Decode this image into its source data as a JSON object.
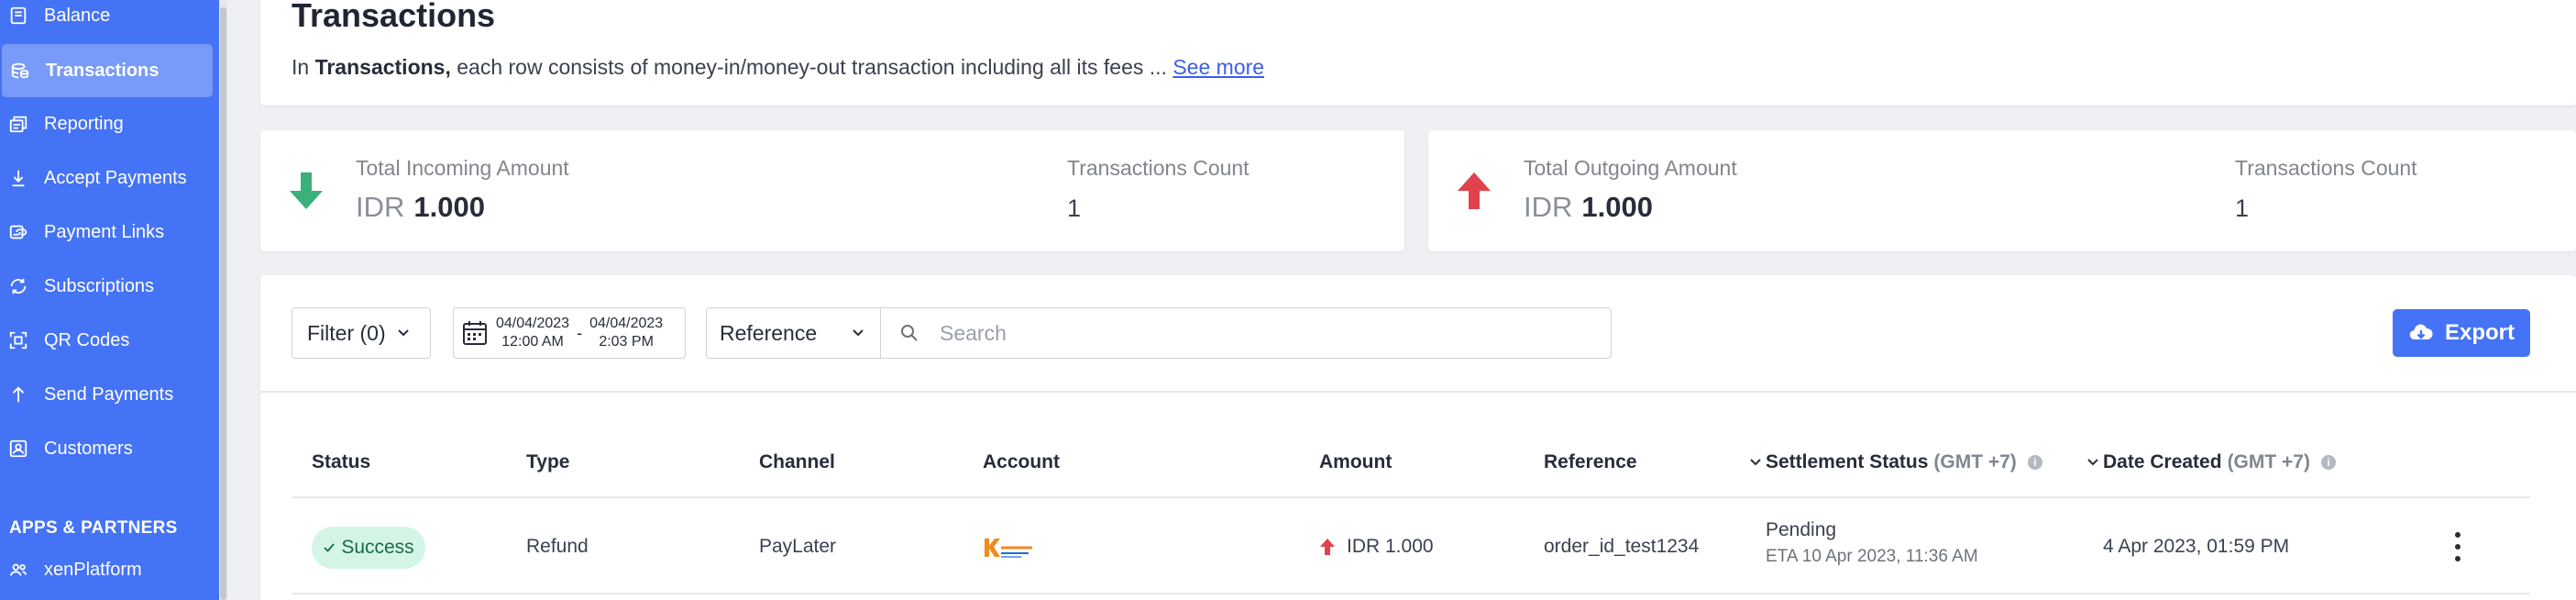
{
  "sidebar": {
    "items": [
      {
        "label": "Balance",
        "icon": "balance-icon"
      },
      {
        "label": "Transactions",
        "icon": "transactions-icon",
        "active": true
      },
      {
        "label": "Reporting",
        "icon": "reporting-icon"
      },
      {
        "label": "Accept Payments",
        "icon": "accept-payments-icon"
      },
      {
        "label": "Payment Links",
        "icon": "payment-links-icon"
      },
      {
        "label": "Subscriptions",
        "icon": "subscriptions-icon"
      },
      {
        "label": "QR Codes",
        "icon": "qr-code-icon"
      },
      {
        "label": "Send Payments",
        "icon": "send-payments-icon"
      },
      {
        "label": "Customers",
        "icon": "customers-icon"
      }
    ],
    "section_title": "APPS & PARTNERS",
    "apps": [
      {
        "label": "xenPlatform",
        "icon": "users-icon"
      }
    ],
    "color": "#4573f5"
  },
  "header": {
    "title": "Transactions",
    "desc_prefix": "In ",
    "desc_bold": "Transactions,",
    "desc_rest": " each row consists of money-in/money-out transaction including all its fees ... ",
    "see_more": "See more"
  },
  "summary": {
    "incoming": {
      "label": "Total Incoming Amount",
      "currency": "IDR",
      "amount": "1.000",
      "count_label": "Transactions Count",
      "count": "1",
      "arrow_color": "#3ab07a"
    },
    "outgoing": {
      "label": "Total Outgoing Amount",
      "currency": "IDR",
      "amount": "1.000",
      "count_label": "Transactions Count",
      "count": "1",
      "arrow_color": "#e0424c"
    }
  },
  "toolbar": {
    "filter_label": "Filter (0)",
    "date_from": "04/04/2023",
    "time_from": "12:00 AM",
    "date_sep": "-",
    "date_to": "04/04/2023",
    "time_to": "2:03 PM",
    "reference_label": "Reference",
    "search_placeholder": "Search",
    "export_label": "Export"
  },
  "table": {
    "headers": {
      "status": "Status",
      "type": "Type",
      "channel": "Channel",
      "account": "Account",
      "amount": "Amount",
      "reference": "Reference",
      "settlement": "Settlement Status",
      "settlement_tz": "(GMT +7)",
      "date": "Date Created",
      "date_tz": "(GMT +7)"
    },
    "rows": [
      {
        "status": "Success",
        "type": "Refund",
        "channel": "PayLater",
        "account_logo": "kredivo-logo",
        "amount": "IDR 1.000",
        "reference": "order_id_test1234",
        "settlement_status": "Pending",
        "settlement_eta": "ETA 10 Apr 2023, 11:36 AM",
        "date_created": "4 Apr 2023, 01:59 PM"
      }
    ]
  }
}
